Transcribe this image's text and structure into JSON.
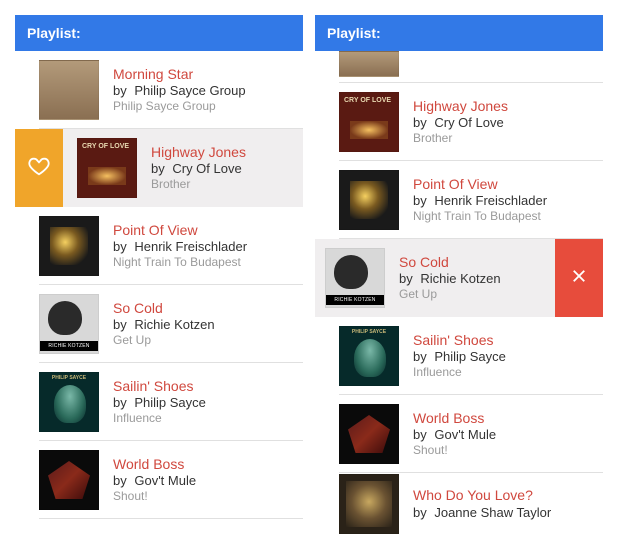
{
  "colors": {
    "header_blue": "#3279e7",
    "title_red": "#d0483e",
    "favorite_orange": "#f0a52a",
    "delete_red": "#e74c3c",
    "swipe_row_bg": "#f0eeef"
  },
  "strings": {
    "by_prefix": "by"
  },
  "left_phone": {
    "header": "Playlist:",
    "tracks": [
      {
        "title": "Morning Star",
        "artist": "Philip Sayce Group",
        "album": "Philip Sayce Group",
        "cover": "cov-sayce",
        "swiped": "none"
      },
      {
        "title": "Highway Jones",
        "artist": "Cry Of Love",
        "album": "Brother",
        "cover": "cov-cry",
        "swiped": "favorite"
      },
      {
        "title": "Point Of View",
        "artist": "Henrik Freischlader",
        "album": "Night Train To Budapest",
        "cover": "cov-night",
        "swiped": "none"
      },
      {
        "title": "So Cold",
        "artist": "Richie Kotzen",
        "album": "Get Up",
        "cover": "cov-kotzen",
        "swiped": "none"
      },
      {
        "title": "Sailin' Shoes",
        "artist": "Philip Sayce",
        "album": "Influence",
        "cover": "cov-influence",
        "swiped": "none"
      },
      {
        "title": "World Boss",
        "artist": "Gov't Mule",
        "album": "Shout!",
        "cover": "cov-mule",
        "swiped": "none"
      }
    ]
  },
  "right_phone": {
    "header": "Playlist:",
    "partial_top": {
      "cover": "cov-sayce"
    },
    "tracks": [
      {
        "title": "Highway Jones",
        "artist": "Cry Of Love",
        "album": "Brother",
        "cover": "cov-cry",
        "swiped": "none"
      },
      {
        "title": "Point Of View",
        "artist": "Henrik Freischlader",
        "album": "Night Train To Budapest",
        "cover": "cov-night",
        "swiped": "none"
      },
      {
        "title": "So Cold",
        "artist": "Richie Kotzen",
        "album": "Get Up",
        "cover": "cov-kotzen",
        "swiped": "delete"
      },
      {
        "title": "Sailin' Shoes",
        "artist": "Philip Sayce",
        "album": "Influence",
        "cover": "cov-influence",
        "swiped": "none"
      },
      {
        "title": "World Boss",
        "artist": "Gov't Mule",
        "album": "Shout!",
        "cover": "cov-mule",
        "swiped": "none"
      },
      {
        "title": "Who Do You Love?",
        "artist": "Joanne Shaw Taylor",
        "album": "",
        "cover": "cov-joanne",
        "swiped": "none",
        "partial_bottom": true
      }
    ]
  }
}
